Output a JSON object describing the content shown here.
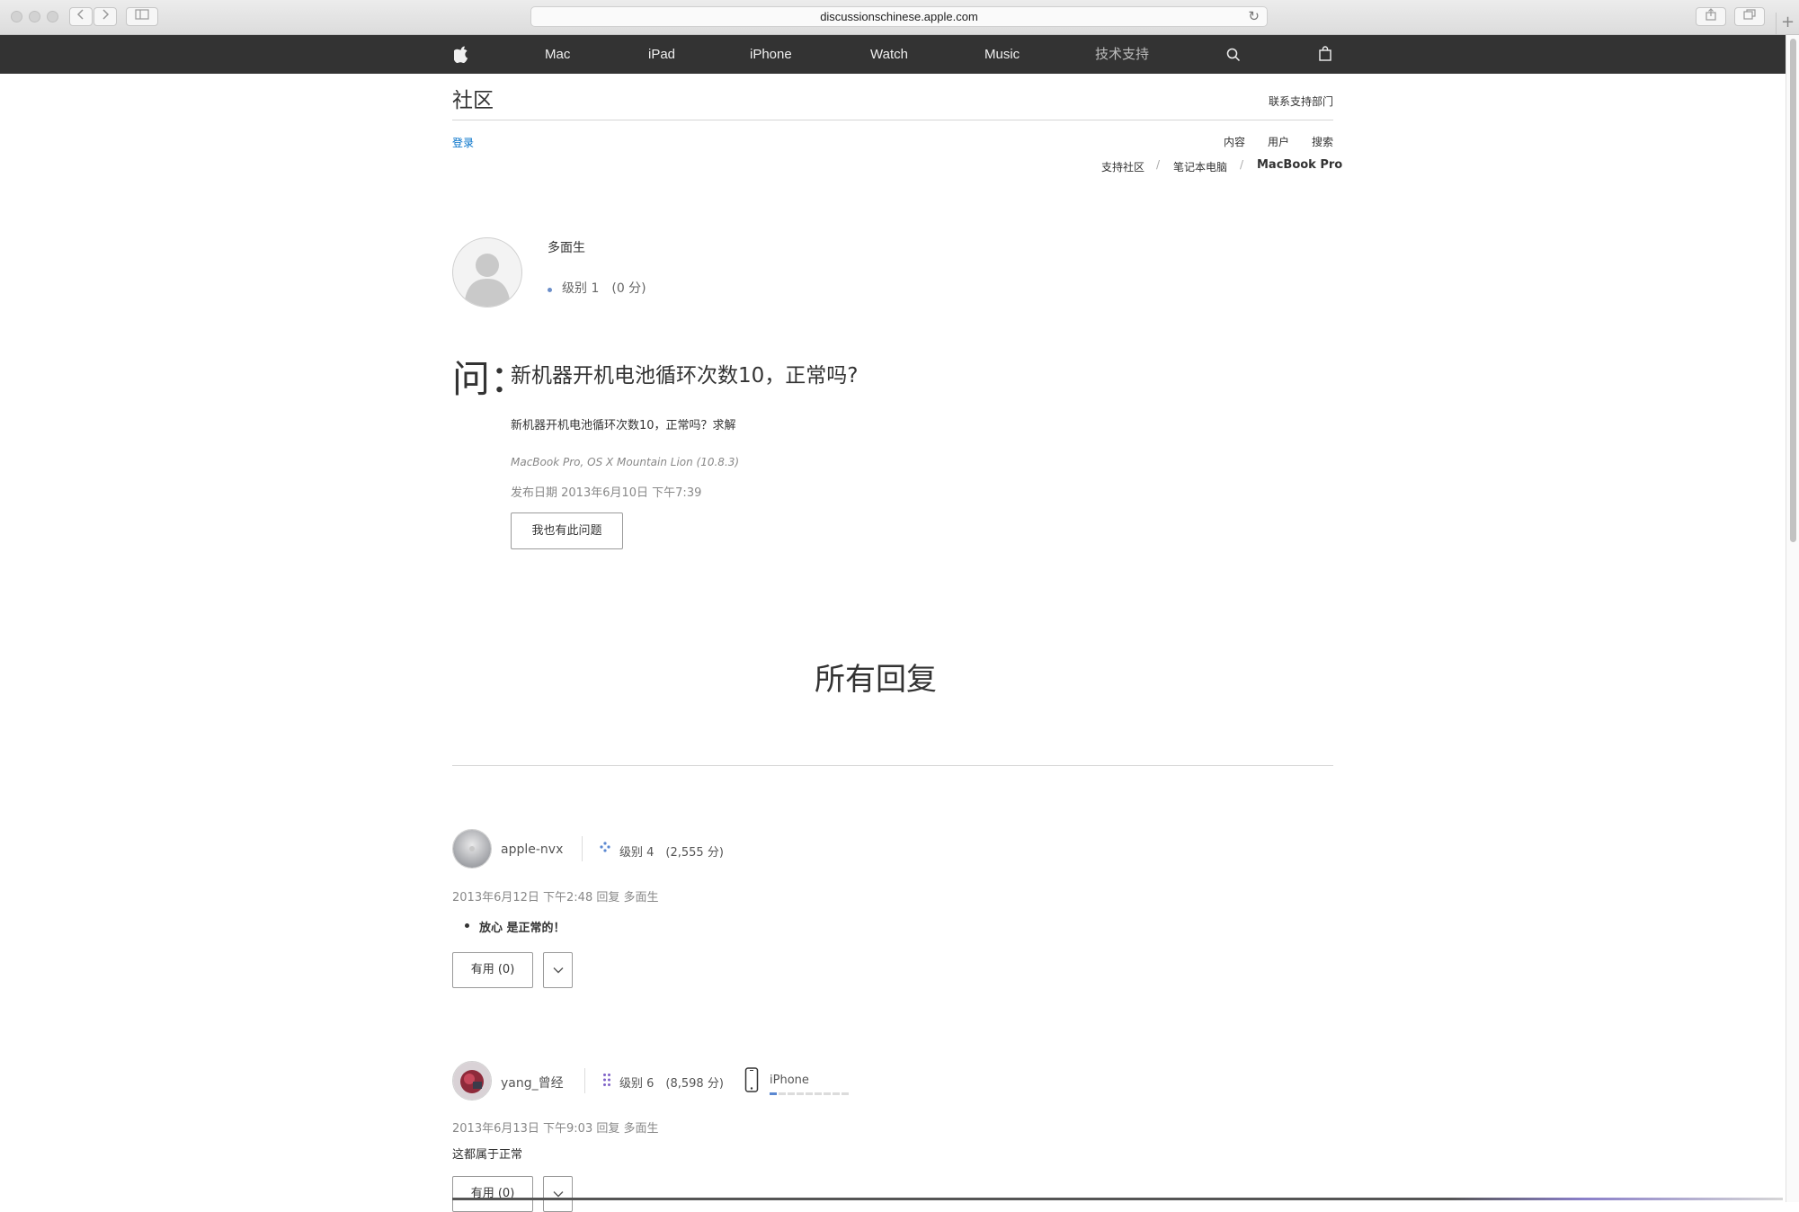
{
  "browser": {
    "url": "discussionschinese.apple.com",
    "reload_icon": "reload-icon",
    "new_tab_label": "+"
  },
  "nav": {
    "items": [
      {
        "label": "Mac"
      },
      {
        "label": "iPad"
      },
      {
        "label": "iPhone"
      },
      {
        "label": "Watch"
      },
      {
        "label": "Music"
      },
      {
        "label": "技术支持"
      }
    ],
    "icons": [
      "apple-logo-icon",
      "search-icon",
      "bag-icon"
    ]
  },
  "header": {
    "title": "社区",
    "support_link": "联系支持部门",
    "login": "登录",
    "subnav": {
      "content": "内容",
      "users": "用户",
      "search": "搜索"
    },
    "breadcrumb": {
      "items": [
        "支持社区",
        "笔记本电脑"
      ],
      "separator": "/",
      "current": "MacBook Pro"
    }
  },
  "question": {
    "author": "多面生",
    "level": "级别 1　(0 分)",
    "prefix": "问：",
    "title": "新机器开机电池循环次数10，正常吗?",
    "body": "新机器开机电池循环次数10，正常吗？求解",
    "device": "MacBook Pro, OS X Mountain Lion (10.8.3)",
    "date": "发布日期 2013年6月10日 下午7:39",
    "me_too_label": "我也有此问题"
  },
  "replies_heading": "所有回复",
  "replies": [
    {
      "user": "apple-nvx",
      "level": "级别 4　(2,555 分)",
      "meta": "2013年6月12日 下午2:48 回复 多面生",
      "body": "放心 是正常的！",
      "helpful_label": "有用 (0)",
      "more_icon": "chevron-down-icon"
    },
    {
      "user": "yang_曾经",
      "level": "级别 6　(8,598 分)",
      "device": "iPhone",
      "meta": "2013年6月13日 下午9:03 回复 多面生",
      "body": "这都属于正常",
      "helpful_label": "有用 (0)",
      "more_icon": "chevron-down-icon"
    }
  ]
}
